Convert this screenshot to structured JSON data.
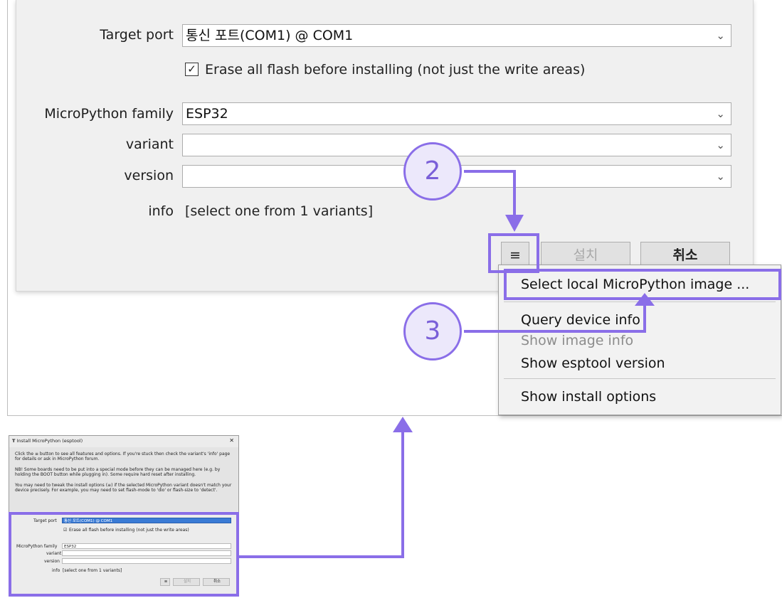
{
  "zoom": {
    "target_port_label": "Target port",
    "target_port_value": "통신 포트(COM1) @ COM1",
    "erase_checkbox_label": "Erase all flash before installing (not just the write areas)",
    "family_label": "MicroPython family",
    "family_value": "ESP32",
    "variant_label": "variant",
    "variant_value": "",
    "version_label": "version",
    "version_value": "",
    "info_label": "info",
    "info_value": "[select one from 1 variants]",
    "menu_button_label": "≡",
    "install_button_label": "설치",
    "cancel_button_label": "취소"
  },
  "menu": {
    "items": [
      "Select local MicroPython image ...",
      "Query device info",
      "Show image info",
      "Show esptool version",
      "Show install options"
    ]
  },
  "callouts": {
    "step2": "2",
    "step3": "3"
  },
  "mini": {
    "title": "Install MicroPython (esptool)",
    "close": "✕",
    "para1": "Click the ≡ button to see all features and options. If you're stuck then check the variant's 'info' page for details or ask in MicroPython forum.",
    "para2": "NB! Some boards need to be put into a special mode before they can be managed here (e.g. by holding the BOOT button while plugging in). Some require hard reset after installing.",
    "para3": "You may need to tweak the install options (≡) if the selected MicroPython variant doesn't match your device precisely. For example, you may need to set flash-mode to 'dio' or flash-size to 'detect'.",
    "target_port_label": "Target port",
    "target_port_value": "통신 포트(COM1) @ COM1",
    "erase_label": "Erase all flash before installing (not just the write areas)",
    "family_label": "MicroPython family",
    "family_value": "ESP32",
    "variant_label": "variant",
    "version_label": "version",
    "info_label": "info",
    "info_value": "[select one from 1 variants]",
    "menu_button_label": "≡",
    "install_button_label": "설치",
    "cancel_button_label": "취소"
  },
  "colors": {
    "accent": "#8a6ee8",
    "selection": "#3a7bd5"
  }
}
